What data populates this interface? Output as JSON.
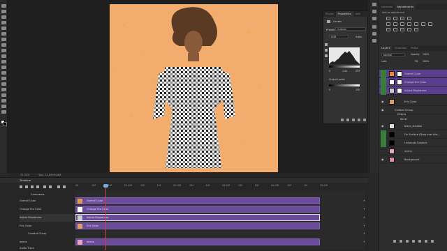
{
  "status_bar": {
    "zoom": "33.33%",
    "doc": "Doc: 15.8M/94.8M"
  },
  "properties": {
    "tabs": [
      "Styles",
      "Properties",
      "Info"
    ],
    "active_tab": "Properties",
    "panel_title": "Levels",
    "preset_label": "Preset:",
    "preset_value": "Custom",
    "channel_value": "RGB",
    "auto_label": "Auto",
    "input_values": [
      "0",
      "1.00",
      "255"
    ],
    "output_label": "Output Levels:",
    "output_values": [
      "0",
      "255"
    ]
  },
  "adjustments": {
    "tabs": [
      "Libraries",
      "Adjustments"
    ],
    "active_tab": "Adjustments",
    "subtitle": "Add an adjustment"
  },
  "layers_panel": {
    "tabs": [
      "Layers",
      "Channels",
      "Paths"
    ],
    "active_tab": "Layers",
    "blend_mode": "Normal",
    "opacity_label": "Opacity:",
    "opacity_value": "100%",
    "fill_label": "Fill:",
    "fill_value": "100%",
    "lock_label": "Lock:",
    "layers": [
      {
        "name": "Overall Color",
        "selected": true
      },
      {
        "name": "Change the Color",
        "selected": true
      },
      {
        "name": "Adjust Brightness",
        "selected": true
      },
      {
        "name": "Eric Color",
        "selected": false
      },
      {
        "name": "Content Group",
        "selected": false
      },
      {
        "name": "Effects",
        "selected": false
      },
      {
        "name": "Bevel",
        "selected": false
      },
      {
        "name": "black_shadow",
        "selected": false
      },
      {
        "name": "On Surface (Drop over the...",
        "selected": false
      },
      {
        "name": "Universal Content",
        "selected": false
      },
      {
        "name": "wrens",
        "selected": false
      },
      {
        "name": "Background",
        "selected": false
      }
    ]
  },
  "timeline": {
    "title": "Timeline",
    "ruler": [
      "00",
      "05f",
      "10f",
      "01:00f",
      "05f",
      "10f",
      "02:00f",
      "05f",
      "10f",
      "03:00f",
      "05f",
      "10f",
      "04:00f",
      "05f",
      "10f",
      "05:00f"
    ],
    "tracks": [
      {
        "name": "Overall Color",
        "clip": "Overall Color",
        "selected": false
      },
      {
        "name": "Change the Color",
        "clip": "Change the Color",
        "selected": false
      },
      {
        "name": "Adjust Brightness",
        "clip": "Adjust Brightness",
        "selected": true
      },
      {
        "name": "Eric Color",
        "clip": "Eric Color",
        "selected": false
      },
      {
        "name": "Content Group",
        "clip": "",
        "selected": false
      },
      {
        "name": "wrens",
        "clip": "wrens",
        "selected": false
      },
      {
        "name": "Audio Track",
        "clip": "",
        "selected": false
      }
    ],
    "comments_label": "Comments"
  },
  "colors": {
    "canvas_bg": "#f2ad6e",
    "layer_selected": "#5b3f8f",
    "clip": "#6b4c9a",
    "playhead": "#d04040"
  }
}
